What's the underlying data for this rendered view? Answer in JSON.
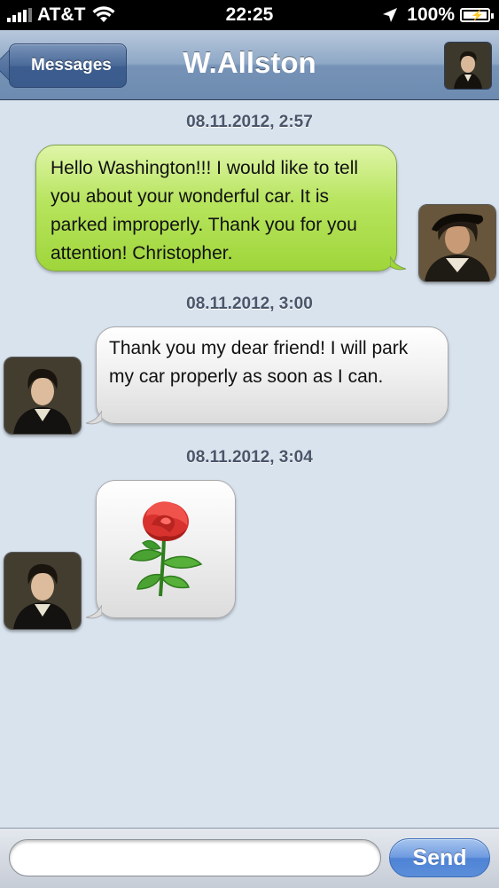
{
  "status_bar": {
    "carrier": "AT&T",
    "time": "22:25",
    "battery": "100%"
  },
  "nav": {
    "back_label": "Messages",
    "title": "W.Allston"
  },
  "messages": [
    {
      "timestamp": "08.11.2012, 2:57",
      "sender": "me",
      "text": "Hello Washington!!! I would like to tell you about your wonderful car. It is parked improperly. Thank you for you attention! Christopher."
    },
    {
      "timestamp": "08.11.2012, 3:00",
      "sender": "contact",
      "text": "Thank you my dear friend! I will park my car properly as soon as I can."
    },
    {
      "timestamp": "08.11.2012, 3:04",
      "sender": "contact",
      "attachment": "rose-image"
    }
  ],
  "input": {
    "value": "",
    "send_label": "Send"
  },
  "colors": {
    "outgoing_bubble": "#b7e45e",
    "incoming_bubble": "#f1f1f1",
    "chat_background": "#d9e3ee",
    "send_button": "#5b8ed9"
  }
}
